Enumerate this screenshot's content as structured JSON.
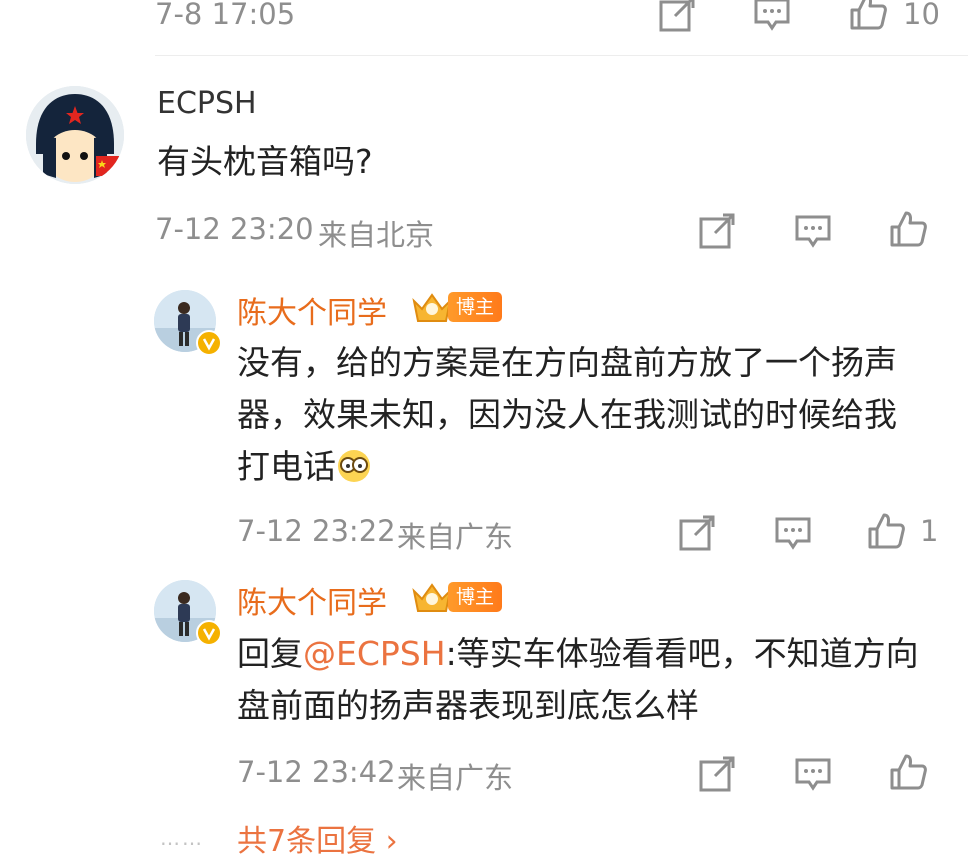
{
  "top_row": {
    "time": "7-8 17:05",
    "like_count": "10"
  },
  "comment": {
    "username": "ECPSH",
    "text": "有头枕音箱吗?",
    "time": "7-12 23:20",
    "location": "来自北京"
  },
  "replies": [
    {
      "username": "陈大个同学",
      "badge_label": "博主",
      "text": "没有，给的方案是在方向盘前方放了一个扬声器，效果未知，因为没人在我测试的时候给我打电话",
      "time": "7-12 23:22",
      "location": "来自广东",
      "like_count": "1"
    },
    {
      "username": "陈大个同学",
      "badge_label": "博主",
      "reply_prefix": "回复",
      "mention": "@ECPSH",
      "text": ":等实车体验看看吧，不知道方向盘前面的扬声器表现到底怎么样",
      "time": "7-12 23:42",
      "location": "来自广东"
    }
  ],
  "more": {
    "dots": "……",
    "label": "共7条回复",
    "chevron": "›"
  },
  "colors": {
    "accent": "#eb7340",
    "meta": "#8e8e8e",
    "text": "#222222"
  }
}
